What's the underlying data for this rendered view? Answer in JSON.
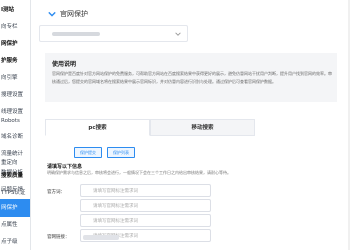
{
  "sidebar": {
    "items": [
      {
        "label": "I测站",
        "active": false,
        "group": true
      },
      {
        "label": "向专栏",
        "active": false,
        "group": false
      },
      {
        "label": "网保护",
        "active": false,
        "group": true
      },
      {
        "label": "护服务",
        "active": false,
        "group": true
      },
      {
        "label": "向引擎",
        "active": false,
        "group": false
      },
      {
        "label": "搜理设置",
        "active": false,
        "group": false
      },
      {
        "label": "线理设置",
        "active": false,
        "group": false
      },
      {
        "label": "Robots",
        "active": false,
        "group": false
      },
      {
        "label": "域名诊断",
        "active": false,
        "group": false
      },
      {
        "label": "流量统计",
        "active": false,
        "group": false
      },
      {
        "label": "重定向",
        "active": false,
        "group": false
      },
      {
        "label": "数据分析",
        "active": false,
        "group": false
      },
      {
        "label": "问题反馈",
        "active": false,
        "group": false
      },
      {
        "label": "搜索质量",
        "active": false,
        "group": true
      },
      {
        "label": "TTPS认证",
        "active": false,
        "group": false
      },
      {
        "label": "网保护",
        "active": true,
        "group": false
      },
      {
        "label": "点属性",
        "active": false,
        "group": false
      },
      {
        "label": "点子级",
        "active": false,
        "group": false
      }
    ]
  },
  "header": {
    "title": "官网保护"
  },
  "site_select": {
    "value": ""
  },
  "notice": {
    "title": "使用说明",
    "text": "官网保护是百度针对官方网站保护的免费服务，可帮助官方网站在百度搜索结果中获得更好的展示，避免仿冒网站干扰用户判断，提升用户找到官网的效率。审核通过后，您提交的官网域名将在搜索结果中展示官网标识，并对仿冒内容进行识别与处理。通过保护后可查看官网保护数据。"
  },
  "tabs": [
    {
      "label": "pc搜索",
      "active": true
    },
    {
      "label": "移动搜索",
      "active": false
    }
  ],
  "pills": [
    "保护提交",
    "保护列表"
  ],
  "section": {
    "title": "请填写以下信息",
    "desc": "明确保护需求与信息之后，审核将会进行，一般情况下会在三个工作日之内给出审核结果，请耐心等待。"
  },
  "fields": [
    {
      "label": "官方词：",
      "placeholder": "请填写官网标注需求词"
    },
    {
      "label": "",
      "placeholder": "请填写官网标注需求词"
    },
    {
      "label": "",
      "placeholder": "请填写官网标注需求词"
    },
    {
      "label": "",
      "placeholder": "请填写官网标注需求词"
    },
    {
      "label": "官网链接：",
      "placeholder": ""
    }
  ],
  "colors": {
    "accent": "#2d8cf0",
    "notice_bg": "#f4f5f7"
  }
}
